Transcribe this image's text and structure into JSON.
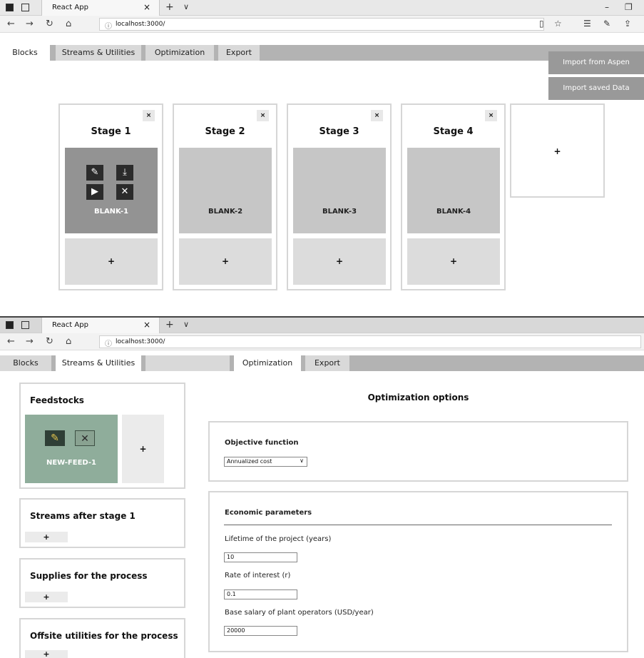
{
  "browser": {
    "tab_title": "React App",
    "tab_close": "×",
    "new_tab": "+",
    "tab_menu": "∨",
    "url": "localhost:3000/",
    "minimize": "–",
    "restore": "❐"
  },
  "tabs": {
    "blocks": "Blocks",
    "streams": "Streams & Utilities",
    "optimization": "Optimization",
    "export": "Export"
  },
  "blocks_panel": {
    "import_aspen": "Import from Aspen",
    "import_saved": "Import saved Data",
    "close_symbol": "×",
    "add_symbol": "+",
    "stages": [
      {
        "title": "Stage 1",
        "block": "BLANK-1"
      },
      {
        "title": "Stage 2",
        "block": "BLANK-2"
      },
      {
        "title": "Stage 3",
        "block": "BLANK-3"
      },
      {
        "title": "Stage 4",
        "block": "BLANK-4"
      }
    ]
  },
  "streams_panel": {
    "feedstocks_title": "Feedstocks",
    "feed_name": "NEW-FEED-1",
    "streams_after": "Streams after stage 1",
    "supplies": "Supplies for the process",
    "offsite": "Offsite utilities for the process",
    "add_symbol": "+"
  },
  "optimization": {
    "title": "Optimization options",
    "objective_label": "Objective function",
    "objective_value": "Annualized cost",
    "economic_title": "Economic parameters",
    "fields": [
      {
        "label": "Lifetime of the project (years)",
        "value": "10"
      },
      {
        "label": "Rate of interest (r)",
        "value": "0.1"
      },
      {
        "label": "Base salary of plant operators (USD/year)",
        "value": "20000"
      }
    ]
  },
  "colors": {
    "active_block": "#939393",
    "inactive_block": "#c6c6c6",
    "feed_green": "#8fad9b",
    "tab_bar": "#b3b3b3"
  }
}
